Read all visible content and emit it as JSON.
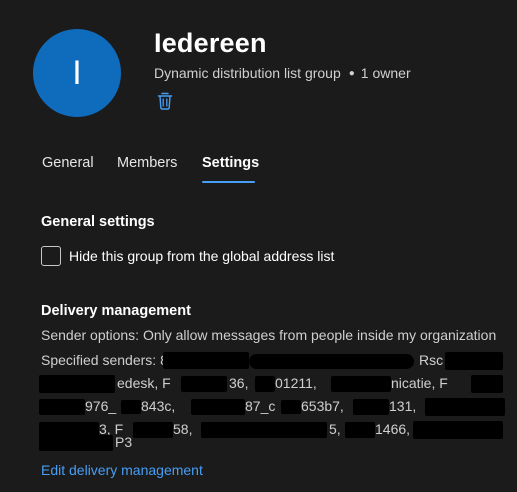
{
  "group": {
    "avatar_initial": "I",
    "name": "Iedereen",
    "type": "Dynamic distribution list group",
    "owners": "1 owner",
    "avatar_color": "#0f6cbd"
  },
  "icons": {
    "delete": "trash-icon"
  },
  "tabs": [
    {
      "label": "General"
    },
    {
      "label": "Members"
    },
    {
      "label": "Settings",
      "active": true
    }
  ],
  "general_settings": {
    "title": "General settings",
    "hide_label": "Hide this group from the global address list",
    "hide_checked": false
  },
  "delivery": {
    "title": "Delivery management",
    "sender_options": "Sender options: Only allow messages from people inside my organization",
    "specified_senders_label": "Specified senders: 8",
    "fragments": {
      "l1a": "Rsc",
      "l2a": "edesk, F",
      "l2b": "36,",
      "l2c": "01211,",
      "l2d": "nicatie, F",
      "l3a": "976_",
      "l3b": "843c,",
      "l3c": "87_c",
      "l3d": "653b7,",
      "l3e": "131,",
      "l4a": "3, F",
      "l4b": "58,",
      "l4c": "5,",
      "l4d": "1466,",
      "l5a": "P3"
    },
    "edit_link": "Edit delivery management"
  },
  "colors": {
    "background": "#1b1b1b",
    "accent": "#479ef5",
    "redaction": "#000000"
  }
}
